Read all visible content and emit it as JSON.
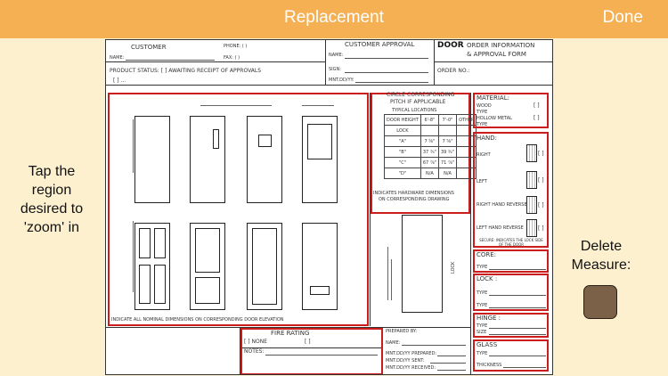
{
  "nav": {
    "title": "Replacement",
    "done_label": "Done"
  },
  "left_panel": {
    "instruction": "Tap the region desired to 'zoom' in"
  },
  "right_panel": {
    "delete_label": "Delete Measure:"
  },
  "form": {
    "customer_label": "CUSTOMER",
    "phone_label": "PHONE: (   )",
    "name_label": "NAME:",
    "fax_label": "FAX: (   )",
    "product_status": "PRODUCT STATUS: [   ] AWAITING RECEIPT OF APPROVALS",
    "status_blank": "[   ] ...",
    "customer_approval_label": "CUSTOMER APPROVAL",
    "approval_name_label": "NAME:",
    "sign_label": "SIGN:",
    "date_label": "MNT.DD/YY:",
    "door_title_bold": "DOOR",
    "door_title_rest": "ORDER INFORMATION",
    "door_title_line2": "& APPROVAL FORM",
    "order_no_label": "ORDER NO.:",
    "elevation_caption": "INDICATE ALL NOMINAL DIMENSIONS ON CORRESPONDING DOOR ELEVATION",
    "pitch_line1": "CIRCLE CORRESPONDING",
    "pitch_line2": "PITCH IF APPLICABLE",
    "typical_locations": "TYPICAL LOCATIONS",
    "door_height_label": "DOOR HEIGHT",
    "col_1": "6'-8\"",
    "col_2": "7'-0\"",
    "col_3": "OTHER",
    "lock_label": "LOCK",
    "row_a": "\"A\"",
    "row_b": "\"B\"",
    "row_c": "\"C\"",
    "row_d": "\"D\"",
    "a_1": "7 ⅝\"",
    "a_2": "7 ⅝\"",
    "b_1": "37 ¾\"",
    "b_2": "39 ¾\"",
    "c_1": "67 ⅞\"",
    "c_2": "71 ⅞\"",
    "d_1": "N/A",
    "d_2": "N/A",
    "hw_caption_1": "INDICATES HARDWARE DIMENSIONS",
    "hw_caption_2": "ON CORRESPONDING DRAWING",
    "lock_side_caption": "LOCK",
    "material_label": "MATERIAL:",
    "wood_label": "WOOD",
    "hollow_metal_label": "HOLLOW METAL",
    "type_label": "TYPE",
    "hand_label": "HAND:",
    "right_label": "RIGHT",
    "left_label": "LEFT",
    "right_reverse_label": "RIGHT HAND REVERSE",
    "left_reverse_label": "LEFT HAND REVERSE",
    "secure_caption": "SECURE: INDICATES THE LOCK SIDE OF THE DOOR",
    "core_label": "CORE:",
    "lock_section_label": "LOCK :",
    "hinge_label": "HINGE :",
    "size_label": "SIZE",
    "glass_label": "GLASS",
    "thickness_label": "THICKNESS",
    "fire_rating_label": "FIRE RATING",
    "none_label": "[   ] NONE",
    "fire_blank": "[   ]",
    "notes_label": "NOTES:",
    "prepared_by_label": "PREPARED BY:",
    "prep_name_label": "NAME:",
    "prepared_date_label": "MNT.DD/YY PREPARED:",
    "sent_date_label": "MNT.DD/YY SENT:",
    "received_date_label": "MNT.DD/YY RECEIVED:",
    "checkbox": "[   ]"
  },
  "colors": {
    "nav_bar": "#f5b054",
    "background": "#fdf0cf",
    "region_outline": "#cc1d1d",
    "delete_swatch": "#7a6148"
  },
  "icons": [
    "hand-right-icon",
    "hand-left-icon",
    "hand-right-reverse-icon",
    "hand-left-reverse-icon"
  ]
}
